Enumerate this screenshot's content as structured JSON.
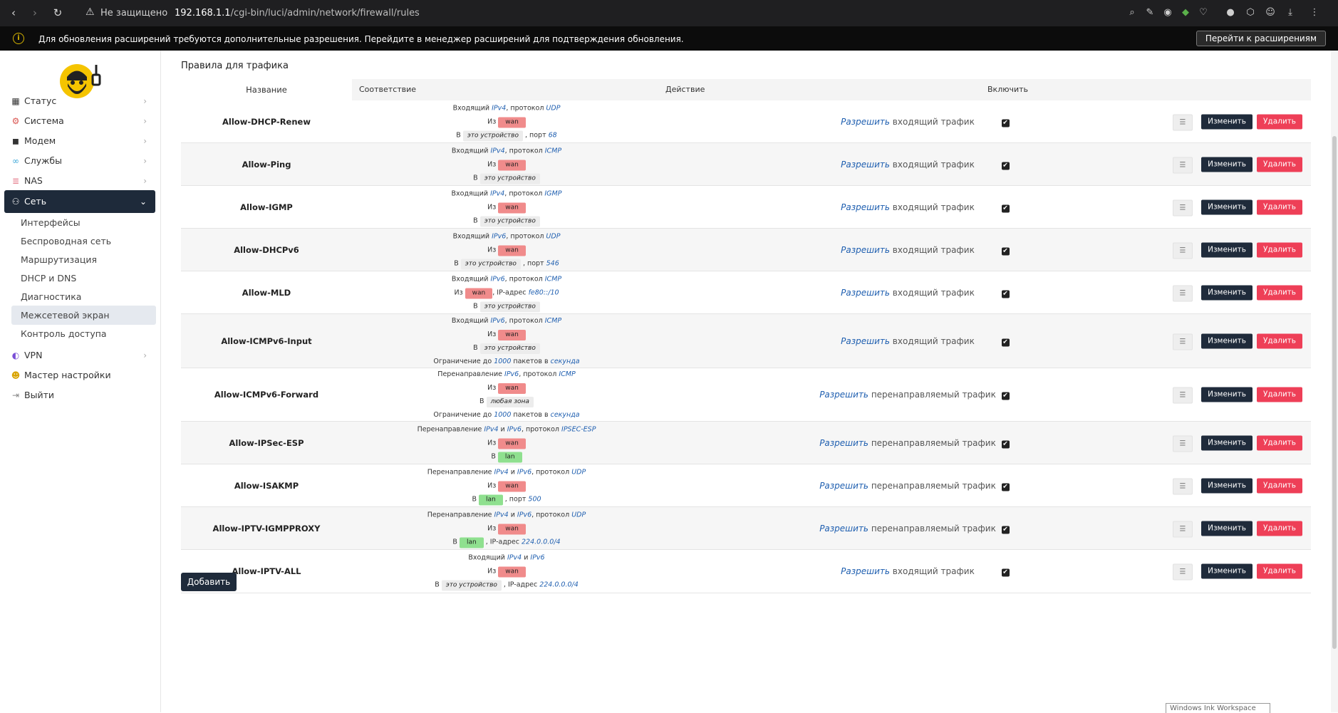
{
  "browser": {
    "not_secure": "Не защищено",
    "url_host": "192.168.1.1",
    "url_path": "/cgi-bin/luci/admin/network/firewall/rules"
  },
  "infobar": {
    "text": "Для обновления расширений требуются дополнительные разрешения. Перейдите в менеджер расширений для подтверждения обновления.",
    "button": "Перейти к расширениям"
  },
  "sidebar": {
    "items": [
      {
        "label": "Статус",
        "icon": "dashboard-icon"
      },
      {
        "label": "Система",
        "icon": "gear-icon"
      },
      {
        "label": "Модем",
        "icon": "cube-icon"
      },
      {
        "label": "Службы",
        "icon": "link-icon"
      },
      {
        "label": "NAS",
        "icon": "database-icon"
      },
      {
        "label": "Сеть",
        "icon": "network-icon"
      }
    ],
    "subitems": [
      "Интерфейсы",
      "Беспроводная сеть",
      "Маршрутизация",
      "DHCP и DNS",
      "Диагностика",
      "Межсетевой экран",
      "Контроль доступа"
    ],
    "bottom": [
      {
        "label": "VPN",
        "icon": "vpn-icon"
      },
      {
        "label": "Мастер настройки",
        "icon": "wizard-icon"
      },
      {
        "label": "Выйти",
        "icon": "logout-icon"
      }
    ]
  },
  "main": {
    "title": "Правила для трафика",
    "headers": {
      "name": "Название",
      "match": "Соответствие",
      "action": "Действие",
      "enable": "Включить"
    },
    "edit_label": "Изменить",
    "delete_label": "Удалить",
    "add_label": "Добавить",
    "drag_glyph": "☰",
    "check_glyph": "✔",
    "rules": [
      {
        "name": "Allow-DHCP-Renew",
        "lines": [
          [
            "t",
            "Входящий "
          ],
          [
            "i",
            "IPv4"
          ],
          [
            "t",
            ", протокол "
          ],
          [
            "i",
            "UDP"
          ]
        ],
        "line2": [
          [
            "t",
            "Из "
          ],
          [
            "wan",
            "wan"
          ]
        ],
        "line3": [
          [
            "t",
            "В "
          ],
          [
            "dev",
            "это устройство"
          ],
          [
            "t",
            " , порт "
          ],
          [
            "i",
            "68"
          ]
        ],
        "action_verb": "Разрешить",
        "action_rest": " входящий трафик"
      },
      {
        "name": "Allow-Ping",
        "lines": [
          [
            "t",
            "Входящий "
          ],
          [
            "i",
            "IPv4"
          ],
          [
            "t",
            ", протокол "
          ],
          [
            "i",
            "ICMP"
          ]
        ],
        "line2": [
          [
            "t",
            "Из "
          ],
          [
            "wan",
            "wan"
          ]
        ],
        "line3": [
          [
            "t",
            "В "
          ],
          [
            "dev",
            "это устройство"
          ]
        ],
        "action_verb": "Разрешить",
        "action_rest": " входящий трафик"
      },
      {
        "name": "Allow-IGMP",
        "lines": [
          [
            "t",
            "Входящий "
          ],
          [
            "i",
            "IPv4"
          ],
          [
            "t",
            ", протокол "
          ],
          [
            "i",
            "IGMP"
          ]
        ],
        "line2": [
          [
            "t",
            "Из "
          ],
          [
            "wan",
            "wan"
          ]
        ],
        "line3": [
          [
            "t",
            "В "
          ],
          [
            "dev",
            "это устройство"
          ]
        ],
        "action_verb": "Разрешить",
        "action_rest": " входящий трафик"
      },
      {
        "name": "Allow-DHCPv6",
        "lines": [
          [
            "t",
            "Входящий "
          ],
          [
            "i",
            "IPv6"
          ],
          [
            "t",
            ", протокол "
          ],
          [
            "i",
            "UDP"
          ]
        ],
        "line2": [
          [
            "t",
            "Из "
          ],
          [
            "wan",
            "wan"
          ]
        ],
        "line3": [
          [
            "t",
            "В "
          ],
          [
            "dev",
            "это устройство"
          ],
          [
            "t",
            " , порт "
          ],
          [
            "i",
            "546"
          ]
        ],
        "action_verb": "Разрешить",
        "action_rest": " входящий трафик"
      },
      {
        "name": "Allow-MLD",
        "lines": [
          [
            "t",
            "Входящий "
          ],
          [
            "i",
            "IPv6"
          ],
          [
            "t",
            ", протокол "
          ],
          [
            "i",
            "ICMP"
          ]
        ],
        "line2": [
          [
            "t",
            "Из "
          ],
          [
            "wan",
            "wan"
          ],
          [
            "t",
            ", IP-адрес "
          ],
          [
            "i",
            "fe80::/10"
          ]
        ],
        "line3": [
          [
            "t",
            "В "
          ],
          [
            "dev",
            "это устройство"
          ]
        ],
        "action_verb": "Разрешить",
        "action_rest": " входящий трафик"
      },
      {
        "name": "Allow-ICMPv6-Input",
        "lines": [
          [
            "t",
            "Входящий "
          ],
          [
            "i",
            "IPv6"
          ],
          [
            "t",
            ", протокол "
          ],
          [
            "i",
            "ICMP"
          ]
        ],
        "line2": [
          [
            "t",
            "Из "
          ],
          [
            "wan",
            "wan"
          ]
        ],
        "line3": [
          [
            "t",
            "В "
          ],
          [
            "dev",
            "это устройство"
          ]
        ],
        "line4": [
          [
            "t",
            "Ограничение до "
          ],
          [
            "i",
            "1000"
          ],
          [
            "t",
            " пакетов в "
          ],
          [
            "i",
            "секунда"
          ]
        ],
        "action_verb": "Разрешить",
        "action_rest": " входящий трафик"
      },
      {
        "name": "Allow-ICMPv6-Forward",
        "lines": [
          [
            "t",
            "Перенаправление "
          ],
          [
            "i",
            "IPv6"
          ],
          [
            "t",
            ", протокол "
          ],
          [
            "i",
            "ICMP"
          ]
        ],
        "line2": [
          [
            "t",
            "Из "
          ],
          [
            "wan",
            "wan"
          ]
        ],
        "line3": [
          [
            "t",
            "В "
          ],
          [
            "dev",
            "любая зона"
          ]
        ],
        "line4": [
          [
            "t",
            "Ограничение до "
          ],
          [
            "i",
            "1000"
          ],
          [
            "t",
            " пакетов в "
          ],
          [
            "i",
            "секунда"
          ]
        ],
        "action_verb": "Разрешить",
        "action_rest": " перенаправляемый трафик"
      },
      {
        "name": "Allow-IPSec-ESP",
        "lines": [
          [
            "t",
            "Перенаправление "
          ],
          [
            "i",
            "IPv4"
          ],
          [
            "t",
            " и "
          ],
          [
            "i",
            "IPv6"
          ],
          [
            "t",
            ", протокол "
          ],
          [
            "i",
            "IPSEC-ESP"
          ]
        ],
        "line2": [
          [
            "t",
            "Из "
          ],
          [
            "wan",
            "wan"
          ]
        ],
        "line3": [
          [
            "t",
            "В "
          ],
          [
            "lan",
            "lan"
          ]
        ],
        "action_verb": "Разрешить",
        "action_rest": " перенаправляемый трафик"
      },
      {
        "name": "Allow-ISAKMP",
        "lines": [
          [
            "t",
            "Перенаправление "
          ],
          [
            "i",
            "IPv4"
          ],
          [
            "t",
            " и "
          ],
          [
            "i",
            "IPv6"
          ],
          [
            "t",
            ", протокол "
          ],
          [
            "i",
            "UDP"
          ]
        ],
        "line2": [
          [
            "t",
            "Из "
          ],
          [
            "wan",
            "wan"
          ]
        ],
        "line3": [
          [
            "t",
            "В "
          ],
          [
            "lan",
            "lan"
          ],
          [
            "t",
            " , порт "
          ],
          [
            "i",
            "500"
          ]
        ],
        "action_verb": "Разрешить",
        "action_rest": " перенаправляемый трафик"
      },
      {
        "name": "Allow-IPTV-IGMPPROXY",
        "lines": [
          [
            "t",
            "Перенаправление "
          ],
          [
            "i",
            "IPv4"
          ],
          [
            "t",
            " и "
          ],
          [
            "i",
            "IPv6"
          ],
          [
            "t",
            ", протокол "
          ],
          [
            "i",
            "UDP"
          ]
        ],
        "line2": [
          [
            "t",
            "Из "
          ],
          [
            "wan",
            "wan"
          ]
        ],
        "line3": [
          [
            "t",
            "В "
          ],
          [
            "lan",
            "lan"
          ],
          [
            "t",
            " , IP-адрес "
          ],
          [
            "i",
            "224.0.0.0/4"
          ]
        ],
        "action_verb": "Разрешить",
        "action_rest": " перенаправляемый трафик"
      },
      {
        "name": "Allow-IPTV-ALL",
        "lines": [
          [
            "t",
            "Входящий "
          ],
          [
            "i",
            "IPv4"
          ],
          [
            "t",
            " и "
          ],
          [
            "i",
            "IPv6"
          ]
        ],
        "line2": [
          [
            "t",
            "Из "
          ],
          [
            "wan",
            "wan"
          ]
        ],
        "line3": [
          [
            "t",
            "В "
          ],
          [
            "dev",
            "это устройство"
          ],
          [
            "t",
            " , IP-адрес "
          ],
          [
            "i",
            "224.0.0.0/4"
          ]
        ],
        "action_verb": "Разрешить",
        "action_rest": " входящий трафик"
      }
    ]
  },
  "taskbar_hint": "Windows Ink Workspace"
}
